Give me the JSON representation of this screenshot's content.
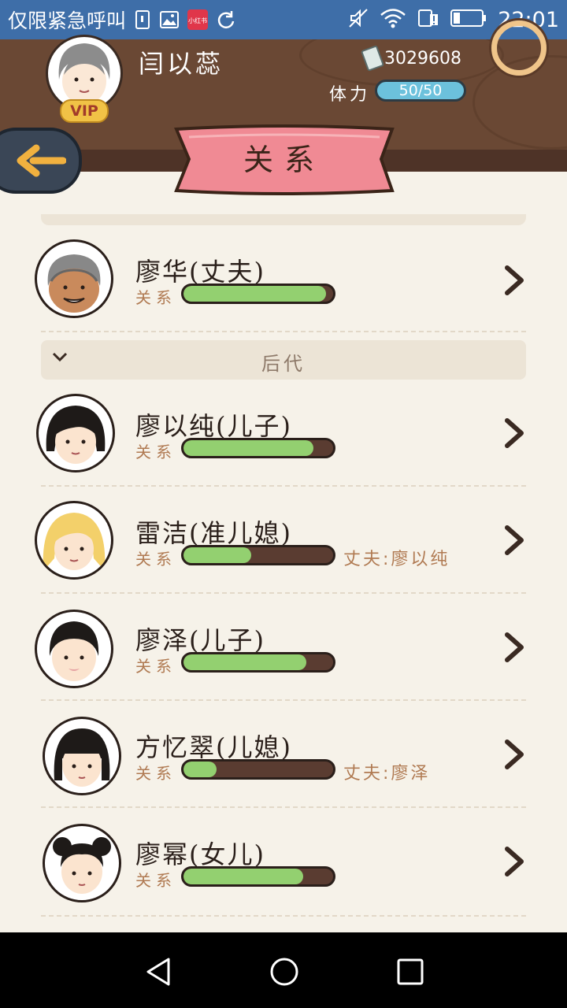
{
  "status_bar": {
    "notice": "仅限紧急呼叫",
    "app_icons": [
      "sim-icon",
      "gallery-icon",
      "xiaohongshu-icon",
      "sync-icon"
    ],
    "xiaohongshu_label": "小红书",
    "right_icons": [
      "mute-icon",
      "wifi-icon",
      "sim-alert-icon",
      "battery-icon"
    ],
    "time": "22:01"
  },
  "header": {
    "player_name": "闫以蕊",
    "vip_label": "VIP",
    "money": "3029608",
    "stamina_label": "体力",
    "stamina_value": "50/50"
  },
  "title": "关系",
  "section_descendants": "后代",
  "rows": [
    {
      "name": "廖华(丈夫)",
      "rel_label": "关系",
      "level": 0.95,
      "spouse": "",
      "avatar": "grandpa"
    },
    {
      "name": "廖以纯(儿子)",
      "rel_label": "关系",
      "level": 0.87,
      "spouse": "",
      "avatar": "man-long-hair"
    },
    {
      "name": "雷洁(准儿媳)",
      "rel_label": "关系",
      "level": 0.45,
      "spouse": "丈夫:廖以纯",
      "avatar": "woman-blonde"
    },
    {
      "name": "廖泽(儿子)",
      "rel_label": "关系",
      "level": 0.82,
      "spouse": "",
      "avatar": "boy-short-hair"
    },
    {
      "name": "方忆翠(儿媳)",
      "rel_label": "关系",
      "level": 0.22,
      "spouse": "丈夫:廖泽",
      "avatar": "woman-bob"
    },
    {
      "name": "廖幂(女儿)",
      "rel_label": "关系",
      "level": 0.8,
      "spouse": "",
      "avatar": "girl-buns"
    }
  ],
  "colors": {
    "accent_pink": "#f08a94",
    "bar_green": "#93d070",
    "stamina_blue": "#6cc1dc",
    "wood_brown": "#6a4834"
  }
}
